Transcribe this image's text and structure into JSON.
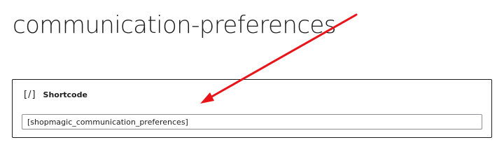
{
  "page": {
    "title": "communication-preferences"
  },
  "shortcode_block": {
    "icon": "shortcode-icon",
    "icon_glyph": "[/]",
    "title": "Shortcode",
    "value": "[shopmagic_communication_preferences]"
  },
  "annotation": {
    "arrow_color": "#e8141a",
    "icon": "red-arrow-icon"
  }
}
